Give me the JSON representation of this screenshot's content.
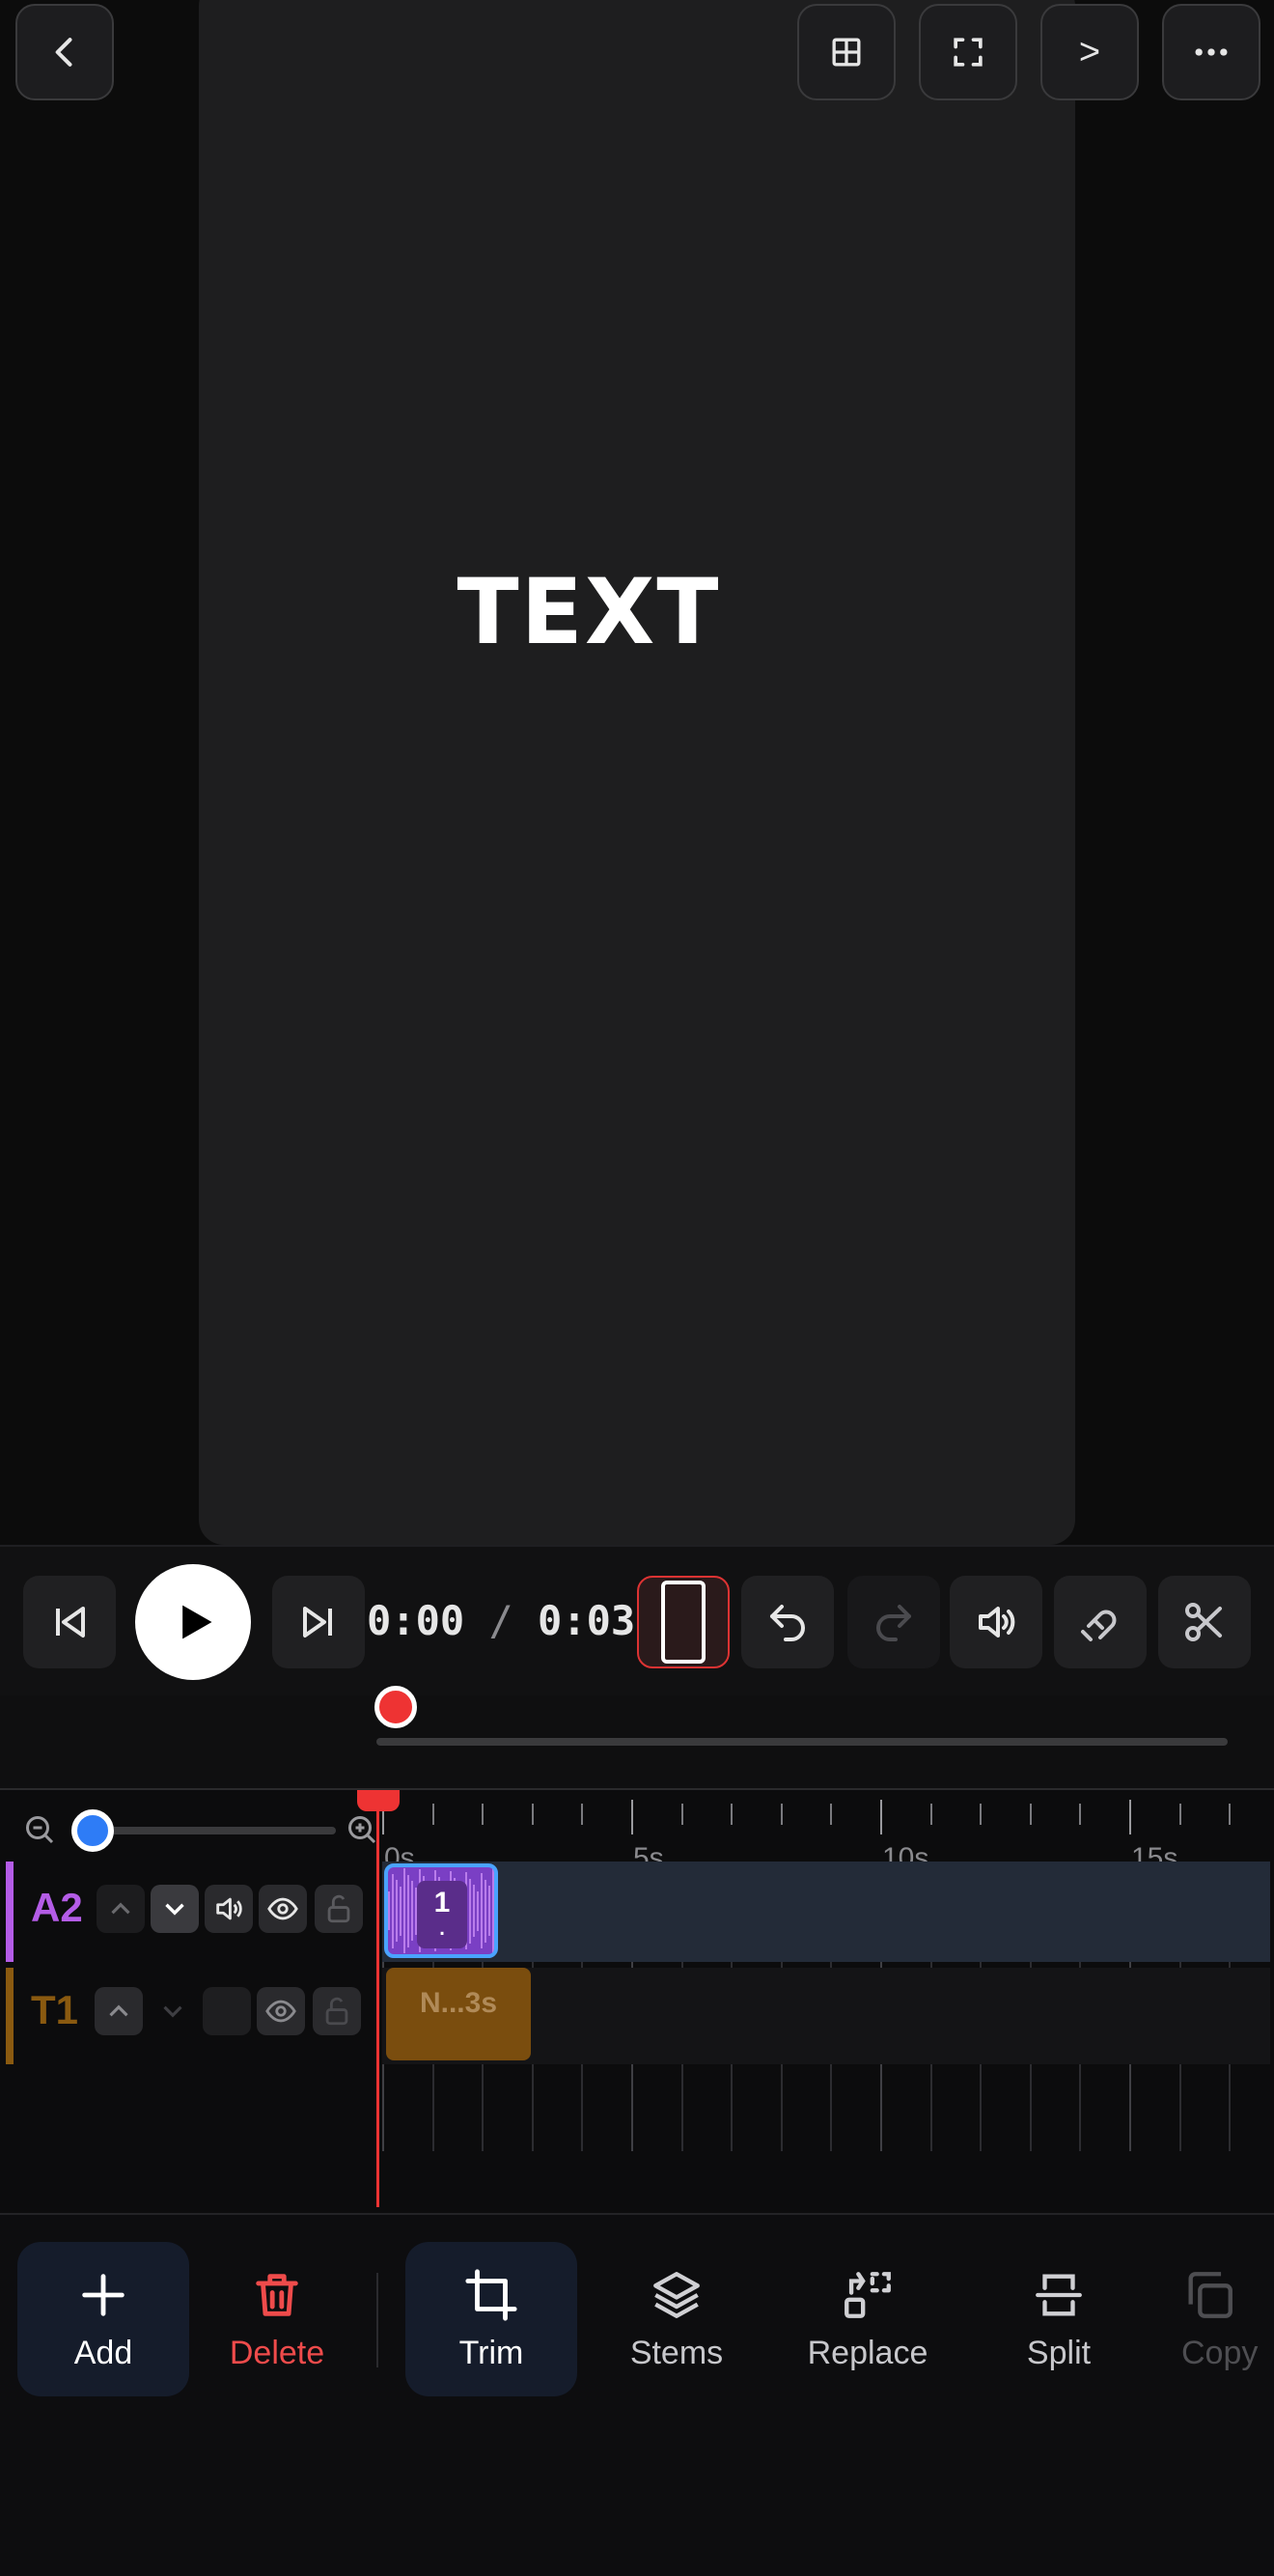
{
  "preview": {
    "text_overlay": "TEXT"
  },
  "top_bar": {
    "back_icon": "chevron-left-icon",
    "buttons": [
      {
        "icon": "grid-icon"
      },
      {
        "icon": "fullscreen-icon"
      },
      {
        "label": ">"
      },
      {
        "icon": "more-icon"
      }
    ]
  },
  "transport": {
    "current_time": "0:00",
    "separator": "/",
    "total_time": "0:03"
  },
  "timeline": {
    "ruler_labels": [
      "0s",
      "5s",
      "10s",
      "15s"
    ],
    "tracks": [
      {
        "id": "A2",
        "color": "#b45ce6",
        "clip_label": "1",
        "clip_sub": "."
      },
      {
        "id": "T1",
        "color": "#8a5a10",
        "clip_label": "N...3s"
      }
    ]
  },
  "toolbar": {
    "items": [
      {
        "label": "Add",
        "icon": "plus-icon"
      },
      {
        "label": "Delete",
        "icon": "trash-icon"
      },
      {
        "label": "Trim",
        "icon": "crop-icon"
      },
      {
        "label": "Stems",
        "icon": "layers-icon"
      },
      {
        "label": "Replace",
        "icon": "replace-icon"
      },
      {
        "label": "Split",
        "icon": "split-icon"
      },
      {
        "label": "Copy",
        "icon": "copy-icon"
      }
    ]
  },
  "colors": {
    "accent_red": "#e33333",
    "accent_blue": "#2e7cf6",
    "audio_purple": "#b45ce6",
    "text_track_orange": "#8a5a10"
  }
}
